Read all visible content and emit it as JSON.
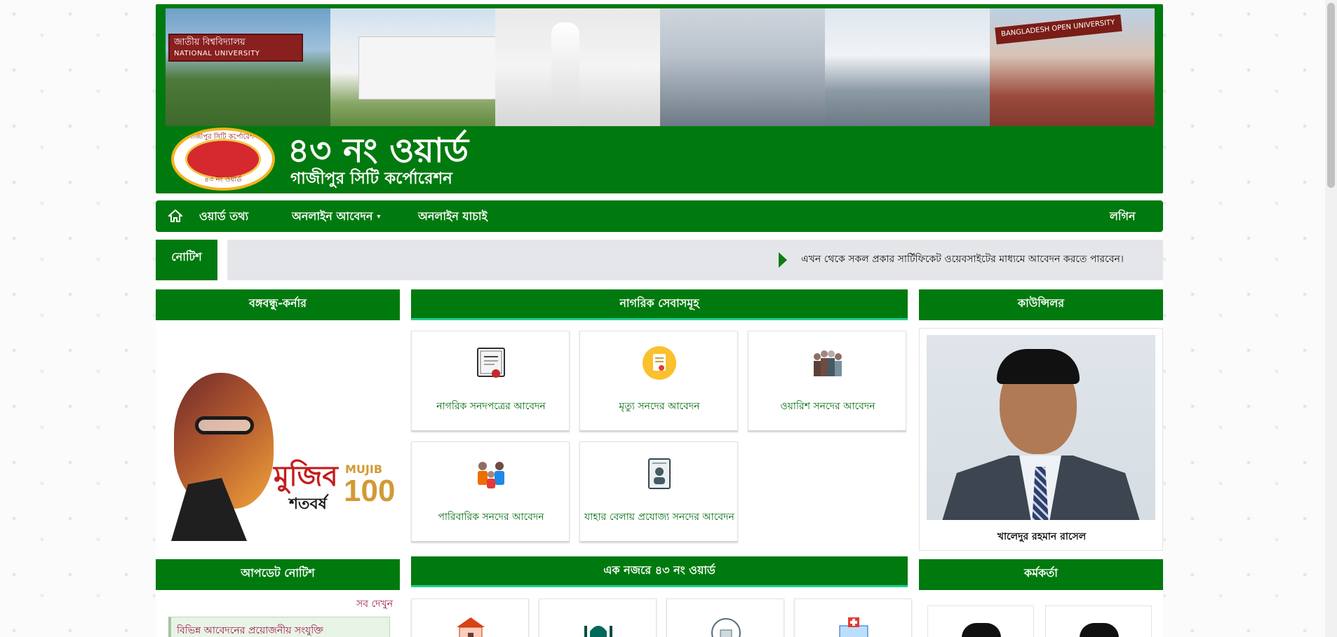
{
  "header": {
    "title": "৪৩ নং ওয়ার্ড",
    "subtitle": "গাজীপুর সিটি কর্পোরেশন",
    "banner_sign_1": "জাতীয় বিশ্ববিদ্যালয়",
    "banner_sign_1_en": "NATIONAL UNIVERSITY",
    "banner_sign_2": "BANGLADESH OPEN UNIVERSITY",
    "logo_top_text": "গাজীপুর সিটি কর্পোরেশন",
    "logo_bottom_text": "৪৩ নং ওয়ার্ড"
  },
  "nav": {
    "home_icon": "home-icon",
    "items": [
      "ওয়ার্ড তথ্য",
      "অনলাইন আবেদন",
      "অনলাইন যাচাই"
    ],
    "login": "লগিন"
  },
  "notice": {
    "label": "নোটিশ",
    "text": "এখন থেকে সকল প্রকার সার্টিফিকেট ওয়েবসাইটের মাধ্যমে আবেদন করতে পারবেন।"
  },
  "columns": {
    "left_title": "বঙ্গবন্ধু-কর্নার",
    "center_title": "নাগরিক সেবাসমূহ",
    "right_title": "কাউন্সিলর"
  },
  "mujib": {
    "word": "মুজিব",
    "word2": "শতবর্ষ",
    "en": "MUJIB",
    "hundred": "100"
  },
  "services": [
    {
      "label": "নাগরিক সনদপত্রের আবেদন",
      "icon": "certificate-icon"
    },
    {
      "label": "মৃত্যু সনদের আবেদন",
      "icon": "death-certificate-icon"
    },
    {
      "label": "ওয়ারিশ সনদের আবেদন",
      "icon": "heirs-icon"
    },
    {
      "label": "পারিবারিক সনদের আবেদন",
      "icon": "family-icon"
    },
    {
      "label": "যাহার বেলায় প্রযোজ্য সনদের আবেদন",
      "icon": "applicable-document-icon"
    }
  ],
  "councillor": {
    "name": "খালেদুর রহমান রাসেল"
  },
  "updates": {
    "title": "আপডেট নোটিশ",
    "see_all": "সব দেখুন",
    "items": [
      "বিভিন্ন আবেদনের প্রয়োজনীয় সংযুক্তি"
    ]
  },
  "glance": {
    "title": "এক নজরে ৪৩ নং ওয়ার্ড",
    "icons": [
      "school-icon",
      "mosque-icon",
      "temple-icon",
      "hospital-icon"
    ]
  },
  "officers": {
    "title": "কর্মকর্তা"
  },
  "colors": {
    "brand_green": "#007a0e",
    "accent_teal": "#1fcf8f",
    "link_maroon": "#a0154e",
    "notice_bg": "#e5e6e9"
  }
}
